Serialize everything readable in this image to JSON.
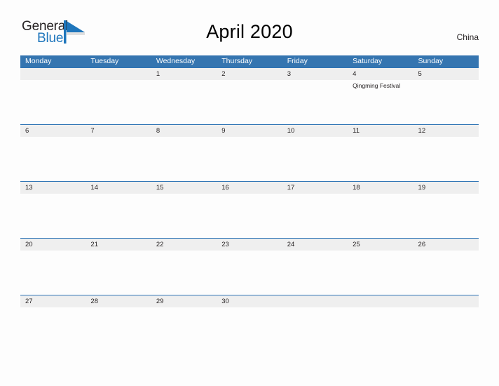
{
  "brand": {
    "name_part1": "General",
    "name_part2": "Blue",
    "flag_icon": "triangle-flag-icon",
    "accent_color": "#1f76bc"
  },
  "header": {
    "title": "April 2020",
    "country": "China"
  },
  "colors": {
    "header_blue": "#3575b0",
    "row_divider_blue": "#2e74b5",
    "date_band_gray": "#efefef",
    "page_background": "#fdfdfd",
    "text": "#231f20"
  },
  "calendar": {
    "month": "April",
    "year": "2020",
    "weekday_headers": [
      "Monday",
      "Tuesday",
      "Wednesday",
      "Thursday",
      "Friday",
      "Saturday",
      "Sunday"
    ],
    "weeks": [
      {
        "days": [
          {
            "num": "",
            "events": []
          },
          {
            "num": "",
            "events": []
          },
          {
            "num": "1",
            "events": []
          },
          {
            "num": "2",
            "events": []
          },
          {
            "num": "3",
            "events": []
          },
          {
            "num": "4",
            "events": [
              "Qingming Festival"
            ]
          },
          {
            "num": "5",
            "events": []
          }
        ]
      },
      {
        "days": [
          {
            "num": "6",
            "events": []
          },
          {
            "num": "7",
            "events": []
          },
          {
            "num": "8",
            "events": []
          },
          {
            "num": "9",
            "events": []
          },
          {
            "num": "10",
            "events": []
          },
          {
            "num": "11",
            "events": []
          },
          {
            "num": "12",
            "events": []
          }
        ]
      },
      {
        "days": [
          {
            "num": "13",
            "events": []
          },
          {
            "num": "14",
            "events": []
          },
          {
            "num": "15",
            "events": []
          },
          {
            "num": "16",
            "events": []
          },
          {
            "num": "17",
            "events": []
          },
          {
            "num": "18",
            "events": []
          },
          {
            "num": "19",
            "events": []
          }
        ]
      },
      {
        "days": [
          {
            "num": "20",
            "events": []
          },
          {
            "num": "21",
            "events": []
          },
          {
            "num": "22",
            "events": []
          },
          {
            "num": "23",
            "events": []
          },
          {
            "num": "24",
            "events": []
          },
          {
            "num": "25",
            "events": []
          },
          {
            "num": "26",
            "events": []
          }
        ]
      },
      {
        "days": [
          {
            "num": "27",
            "events": []
          },
          {
            "num": "28",
            "events": []
          },
          {
            "num": "29",
            "events": []
          },
          {
            "num": "30",
            "events": []
          },
          {
            "num": "",
            "events": []
          },
          {
            "num": "",
            "events": []
          },
          {
            "num": "",
            "events": []
          }
        ]
      }
    ]
  }
}
